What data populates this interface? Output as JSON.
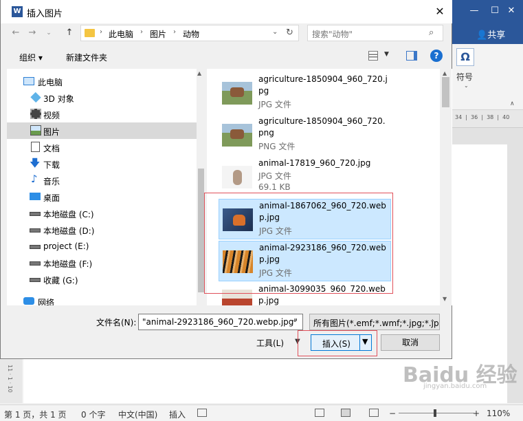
{
  "dialog": {
    "title": "插入图片",
    "logo_letter": "W",
    "close": "✕",
    "address": {
      "crumbs": [
        "此电脑",
        "图片",
        "动物"
      ],
      "separator": "›"
    },
    "search_placeholder": "搜索\"动物\"",
    "toolbar": {
      "organize": "组织 ▾",
      "new_folder": "新建文件夹",
      "help": "?"
    },
    "nav": [
      {
        "label": "此电脑",
        "icon": "computer-icon"
      },
      {
        "label": "3D 对象",
        "icon": "cube-icon"
      },
      {
        "label": "视频",
        "icon": "video-icon"
      },
      {
        "label": "图片",
        "icon": "pictures-icon",
        "selected": true
      },
      {
        "label": "文档",
        "icon": "document-icon"
      },
      {
        "label": "下载",
        "icon": "download-icon"
      },
      {
        "label": "音乐",
        "icon": "music-icon"
      },
      {
        "label": "桌面",
        "icon": "desktop-icon"
      },
      {
        "label": "本地磁盘 (C:)",
        "icon": "drive-icon"
      },
      {
        "label": "本地磁盘 (D:)",
        "icon": "drive-icon"
      },
      {
        "label": "project (E:)",
        "icon": "drive-icon"
      },
      {
        "label": "本地磁盘 (F:)",
        "icon": "drive-icon"
      },
      {
        "label": "收藏 (G:)",
        "icon": "drive-icon"
      },
      {
        "label": "网络",
        "icon": "network-icon"
      }
    ],
    "files": [
      {
        "name": "agriculture-1850904_960_720.jpg",
        "type": "JPG 文件",
        "size": "",
        "selected": false
      },
      {
        "name": "agriculture-1850904_960_720.png",
        "type": "PNG 文件",
        "size": "",
        "selected": false
      },
      {
        "name": "animal-17819_960_720.jpg",
        "type": "JPG 文件",
        "size": "69.1 KB",
        "selected": false
      },
      {
        "name": "animal-1867062_960_720.webp.jpg",
        "type": "JPG 文件",
        "size": "",
        "selected": true
      },
      {
        "name": "animal-2923186_960_720.webp.jpg",
        "type": "JPG 文件",
        "size": "",
        "selected": true
      },
      {
        "name": "animal-3099035_960_720.webp.jpg",
        "type": "",
        "size": "",
        "selected": false
      }
    ],
    "filename_label": "文件名(N):",
    "filename_value": "\"animal-2923186_960_720.webp.jpg\"",
    "filter_value": "所有图片(*.emf;*.wmf;*.jpg;*.jp",
    "tools_label": "工具(L)",
    "insert_label": "插入(S)",
    "cancel_label": "取消"
  },
  "word": {
    "share": "共享",
    "symbol_label": "符号",
    "symbol_glyph": "Ω",
    "ruler_text": "34  |  36  |  38  |  40",
    "left_ruler": "11 · 1 · 10",
    "statusbar": {
      "page": "第 1 页，共 1 页",
      "words": "0 个字",
      "language": "中文(中国)",
      "mode": "插入",
      "zoom": "110%"
    }
  },
  "watermark": {
    "text": "Baidu 经验",
    "sub": "jingyan.baidu.com"
  }
}
